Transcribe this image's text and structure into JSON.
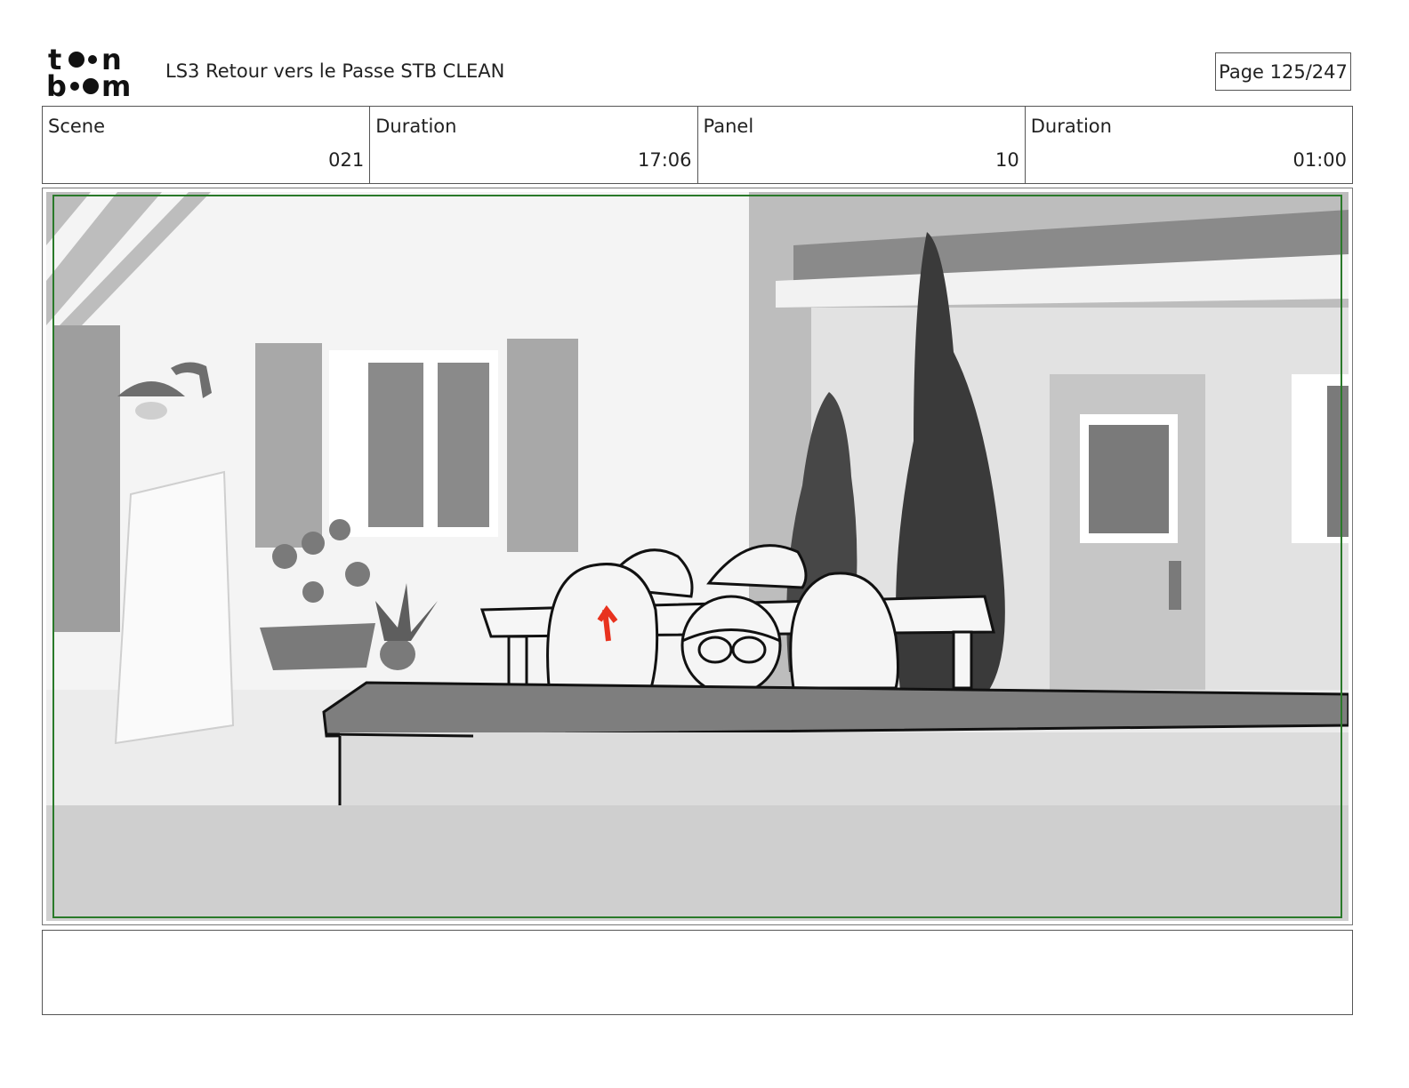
{
  "header": {
    "logo_text": "toon boom",
    "document_title": "LS3 Retour vers le Passe STB CLEAN",
    "page_indicator": "Page 125/247"
  },
  "info": {
    "scene_label": "Scene",
    "scene_value": "021",
    "scene_duration_label": "Duration",
    "scene_duration_value": "17:06",
    "panel_label": "Panel",
    "panel_value": "10",
    "panel_duration_label": "Duration",
    "panel_duration_value": "01:00"
  },
  "panel": {
    "safe_area_color": "#2a7a2a",
    "accent_mark_color": "#e8321e"
  },
  "notes": {
    "text": ""
  }
}
